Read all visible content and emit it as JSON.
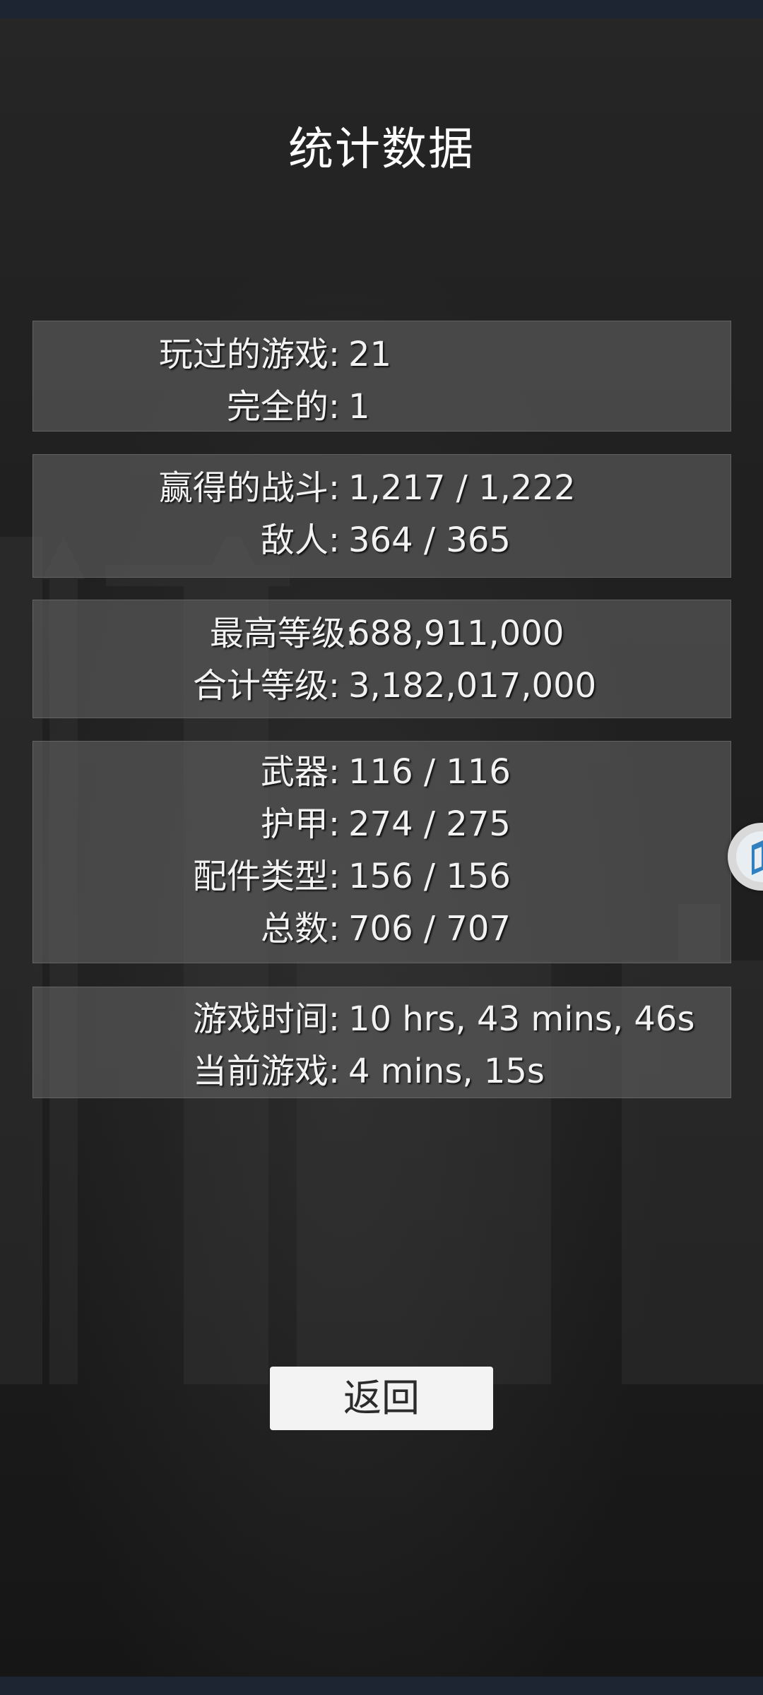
{
  "title": "统计数据",
  "sections": [
    {
      "rows": [
        {
          "label": "玩过的游戏:",
          "value": "21"
        },
        {
          "label": "完全的:",
          "value": "1"
        }
      ]
    },
    {
      "rows": [
        {
          "label": "赢得的战斗:",
          "value": "1,217 / 1,222"
        },
        {
          "label": "敌人:",
          "value": "364 / 365"
        }
      ]
    },
    {
      "rows": [
        {
          "label": "最高等级:",
          "value": "688,911,000"
        },
        {
          "label": "合计等级:",
          "value": "3,182,017,000"
        }
      ]
    },
    {
      "rows": [
        {
          "label": "武器:",
          "value": "116 / 116"
        },
        {
          "label": "护甲:",
          "value": "274 / 275"
        },
        {
          "label": "配件类型:",
          "value": "156 / 156"
        },
        {
          "label": "总数:",
          "value": "706 / 707"
        }
      ]
    },
    {
      "rows": [
        {
          "label": "游戏时间:",
          "value": "10 hrs, 43 mins, 46s"
        },
        {
          "label": "当前游戏:",
          "value": "4 mins, 15s"
        }
      ]
    }
  ],
  "back_button": {
    "label": "返回"
  },
  "floating_widget": {
    "icon": "cube-icon",
    "color": "#2f7fc1"
  }
}
